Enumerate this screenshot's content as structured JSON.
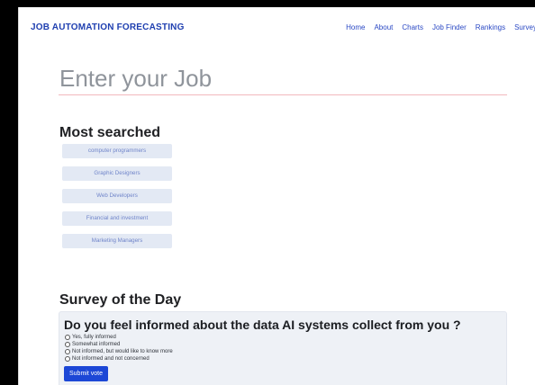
{
  "app": {
    "brand": "JOB AUTOMATION FORECASTING"
  },
  "nav": {
    "items": [
      {
        "label": "Home"
      },
      {
        "label": "About"
      },
      {
        "label": "Charts"
      },
      {
        "label": "Job Finder"
      },
      {
        "label": "Rankings"
      },
      {
        "label": "Survey"
      }
    ]
  },
  "search": {
    "placeholder": "Enter your Job",
    "value": ""
  },
  "most_searched": {
    "title": "Most searched",
    "items": [
      {
        "label": "computer programmers"
      },
      {
        "label": "Graphic Designers"
      },
      {
        "label": "Web Developers"
      },
      {
        "label": "Financial and investment"
      },
      {
        "label": "Marketing Managers"
      }
    ]
  },
  "survey": {
    "title": "Survey of the Day",
    "question": "Do you feel informed about the data AI systems collect from you ?",
    "options": [
      {
        "label": "Yes, fully informed"
      },
      {
        "label": "Somewhat informed"
      },
      {
        "label": "Not informed, but would like to know more"
      },
      {
        "label": "Not informed and not concerned"
      }
    ],
    "submit_label": "Submit vote"
  },
  "colors": {
    "brand": "#1f3fb0",
    "nav_link": "#2a48c4",
    "chip_bg": "#e3e9f4",
    "chip_text": "#6f84c9",
    "input_underline": "#f2b8bd",
    "submit_bg": "#1c47d6",
    "survey_card_bg": "#eef1f6"
  }
}
